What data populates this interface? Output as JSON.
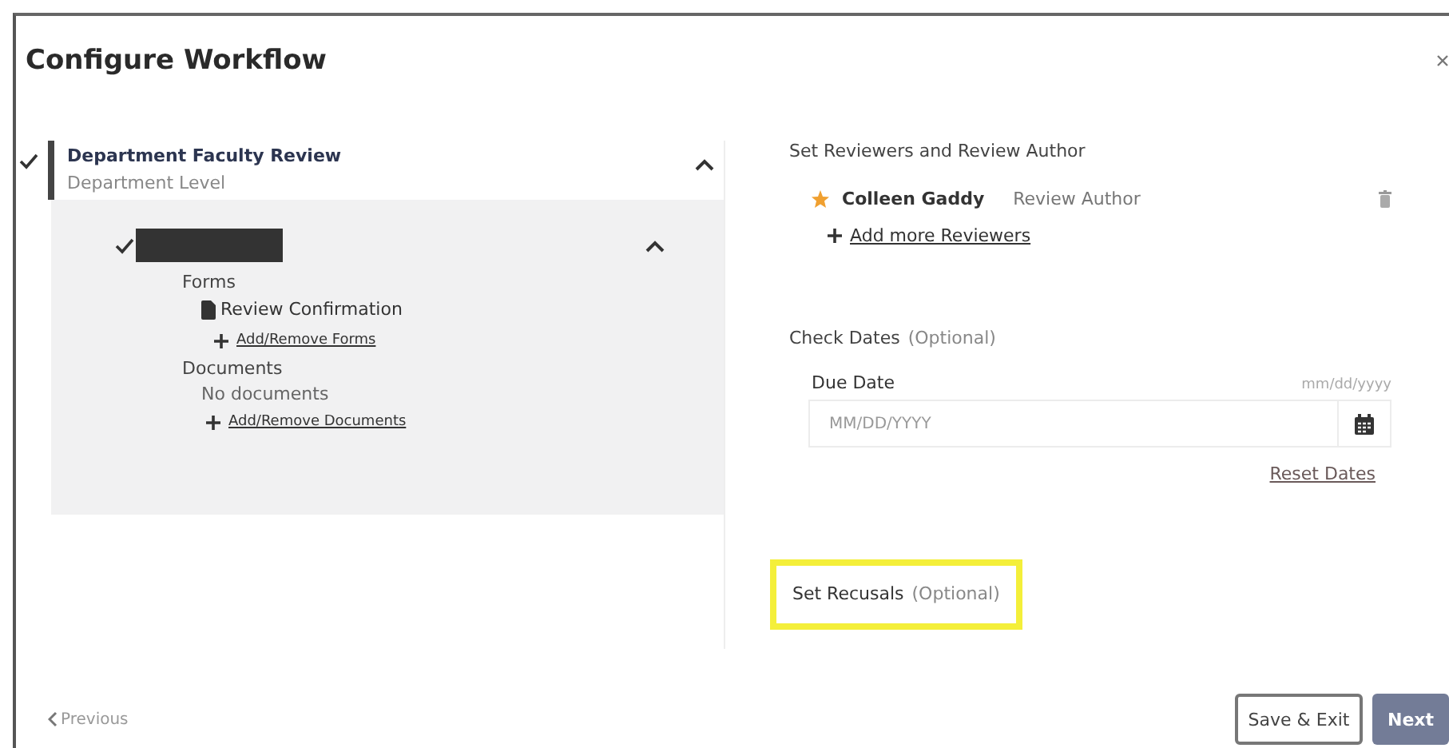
{
  "window": {
    "title": "Configure Workflow"
  },
  "stage": {
    "title": "Department Faculty Review",
    "subtitle": "Department Level",
    "checked": true,
    "expanded": true,
    "step": {
      "checked": true,
      "expanded": true,
      "redacted": true,
      "forms": {
        "heading": "Forms",
        "items": [
          "Review Confirmation"
        ],
        "link": "Add/Remove Forms"
      },
      "documents": {
        "heading": "Documents",
        "empty": "No documents",
        "link": "Add/Remove Documents"
      }
    }
  },
  "reviewers": {
    "heading": "Set Reviewers and Review Author",
    "people": [
      {
        "name": "Colleen Gaddy",
        "role": "Review Author",
        "author": true
      }
    ],
    "link": "Add more Reviewers"
  },
  "dates": {
    "heading": "Check Dates",
    "optional": "(Optional)",
    "label": "Due Date",
    "format": "mm/dd/yyyy",
    "placeholder": "MM/DD/YYYY",
    "reset": "Reset Dates"
  },
  "recusals": {
    "heading": "Set Recusals",
    "optional": "(Optional)",
    "highlighted": true
  },
  "footer": {
    "previous": "Previous",
    "buttons": [
      {
        "label": "Save & Exit",
        "kind": "secondary"
      },
      {
        "label": "Next",
        "kind": "primary"
      }
    ]
  }
}
